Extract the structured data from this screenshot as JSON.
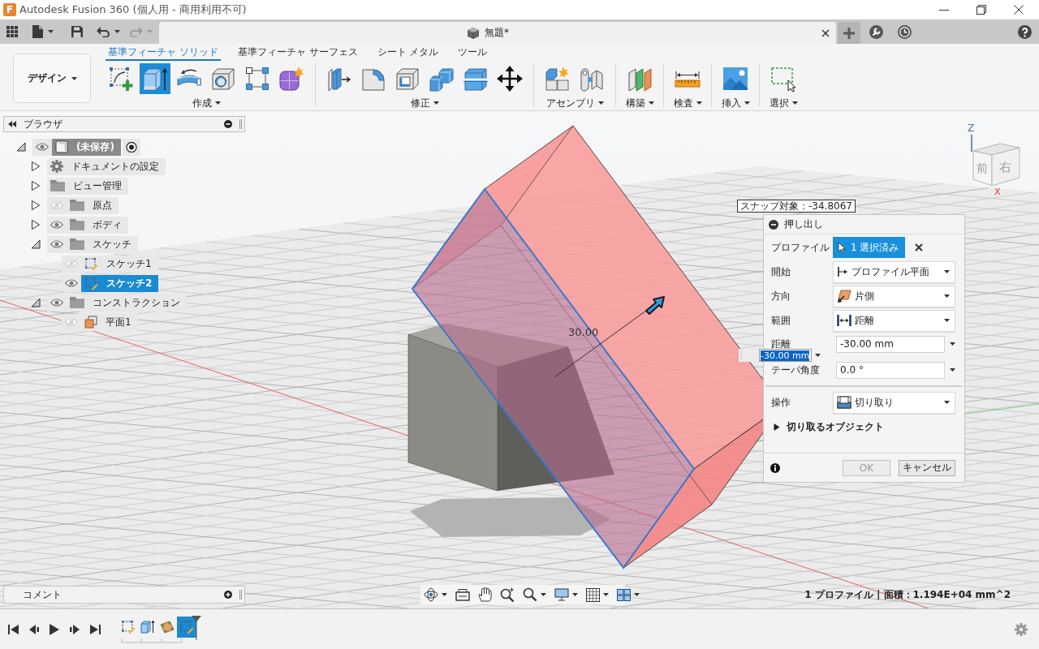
{
  "window": {
    "logo": "F",
    "title": "Autodesk Fusion 360 (個人用 - 商用利用不可)"
  },
  "quick_access": [
    {
      "kind": "apps",
      "disabled": false
    },
    {
      "kind": "file",
      "disabled": false
    },
    {
      "kind": "save",
      "disabled": false
    },
    {
      "kind": "undo",
      "disabled": false
    },
    {
      "kind": "redo",
      "disabled": true
    }
  ],
  "document_tab": {
    "title": "無題*"
  },
  "toolbar": {
    "workspace": "デザイン",
    "tabs": [
      {
        "label": "基準フィーチャ ソリッド",
        "selected": true
      },
      {
        "label": "基準フィーチャ サーフェス",
        "selected": false
      },
      {
        "label": "シート メタル",
        "selected": false
      },
      {
        "label": "ツール",
        "selected": false
      }
    ],
    "groups": [
      {
        "label": "作成",
        "tools": [
          {
            "kind": "sketch",
            "selected": false
          },
          {
            "kind": "extrude",
            "selected": true
          },
          {
            "kind": "revolve",
            "selected": false
          },
          {
            "kind": "hole",
            "selected": false
          },
          {
            "kind": "pattern",
            "selected": false
          },
          {
            "kind": "form",
            "selected": false
          }
        ]
      },
      {
        "label": "修正",
        "tools": [
          {
            "kind": "presspull",
            "selected": false
          },
          {
            "kind": "fillet",
            "selected": false
          },
          {
            "kind": "shell",
            "selected": false
          },
          {
            "kind": "combine",
            "selected": false
          },
          {
            "kind": "split",
            "selected": false
          },
          {
            "kind": "move",
            "selected": false
          }
        ]
      },
      {
        "label": "アセンブリ",
        "tools": [
          {
            "kind": "component",
            "selected": false
          },
          {
            "kind": "joint",
            "selected": false
          }
        ]
      },
      {
        "label": "構築",
        "tools": [
          {
            "kind": "plane",
            "selected": false
          }
        ]
      },
      {
        "label": "検査",
        "tools": [
          {
            "kind": "measure",
            "selected": false
          }
        ]
      },
      {
        "label": "挿入",
        "tools": [
          {
            "kind": "image",
            "selected": false
          }
        ]
      },
      {
        "label": "選択",
        "tools": [
          {
            "kind": "select",
            "selected": false
          }
        ]
      }
    ]
  },
  "browser": {
    "title": "ブラウザ",
    "tree": [
      {
        "kind": "component",
        "label": "(未保存)",
        "expanded": true,
        "visible": true,
        "selected": false,
        "active": true,
        "children": [
          {
            "kind": "settings",
            "label": "ドキュメントの設定",
            "expanded": false,
            "selected": false
          },
          {
            "kind": "folder",
            "label": "ビュー管理",
            "expanded": false,
            "selected": false
          },
          {
            "kind": "folder",
            "label": "原点",
            "expanded": false,
            "visible": false,
            "selected": false
          },
          {
            "kind": "folder",
            "label": "ボディ",
            "expanded": false,
            "visible": true,
            "selected": false
          },
          {
            "kind": "folder",
            "label": "スケッチ",
            "expanded": true,
            "visible": true,
            "selected": false,
            "children": [
              {
                "kind": "sketch",
                "label": "スケッチ1",
                "visible": false,
                "selected": false
              },
              {
                "kind": "sketch",
                "label": "スケッチ2",
                "visible": true,
                "selected": true
              }
            ]
          },
          {
            "kind": "folder",
            "label": "コンストラクション",
            "expanded": true,
            "visible": true,
            "selected": false,
            "children": [
              {
                "kind": "plane",
                "label": "平面1",
                "visible": false,
                "selected": false
              }
            ]
          }
        ]
      }
    ]
  },
  "viewport": {
    "snap_hint": "スナップ対象：-34.8067",
    "dimension": "30.00",
    "distance_input": {
      "value": "-30.00 mm",
      "text_selected": true
    },
    "view_cube": {
      "front": "前",
      "right": "右",
      "axes": [
        "Z",
        "X"
      ]
    }
  },
  "dialog": {
    "title": "押し出し",
    "rows": [
      {
        "kind": "profile",
        "label": "プロファイル",
        "value": "1 選択済み"
      },
      {
        "kind": "start",
        "label": "開始",
        "value": "プロファイル平面"
      },
      {
        "kind": "direction",
        "label": "方向",
        "value": "片側"
      },
      {
        "kind": "extent",
        "label": "範囲",
        "value": "距離"
      },
      {
        "kind": "distance",
        "label": "距離",
        "value": "-30.00 mm"
      },
      {
        "kind": "taper",
        "label": "テーパ角度",
        "value": "0.0 °"
      },
      {
        "kind": "operation",
        "label": "操作",
        "value": "切り取り"
      }
    ],
    "section": {
      "label": "切り取るオブジェクト",
      "expanded": false
    },
    "buttons": [
      {
        "label": "OK",
        "disabled": true
      },
      {
        "label": "キャンセル",
        "disabled": false
      }
    ]
  },
  "comments": {
    "title": "コメント"
  },
  "status": "1 プロファイル | 面積：1.194E+04 mm^2",
  "timeline": {
    "items": [
      {
        "kind": "sketch",
        "selected": false
      },
      {
        "kind": "extrude",
        "selected": false
      },
      {
        "kind": "plane",
        "selected": false
      },
      {
        "kind": "sketch",
        "selected": true
      }
    ]
  }
}
